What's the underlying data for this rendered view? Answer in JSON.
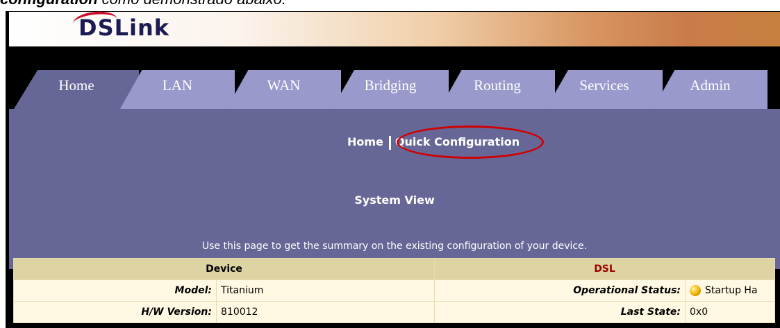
{
  "caption": {
    "bold_part": "configuration",
    "rest": " como demonstrado abaixo:"
  },
  "brand": {
    "logo_text": "DSLink"
  },
  "tabs": [
    {
      "label": "Home",
      "active": true
    },
    {
      "label": "LAN",
      "active": false
    },
    {
      "label": "WAN",
      "active": false
    },
    {
      "label": "Bridging",
      "active": false
    },
    {
      "label": "Routing",
      "active": false
    },
    {
      "label": "Services",
      "active": false
    },
    {
      "label": "Admin",
      "active": false
    }
  ],
  "subnav": {
    "home": "Home",
    "quick_config": "Quick Configuration"
  },
  "page": {
    "title": "System View",
    "description": "Use this page to get the summary on the existing configuration of your device."
  },
  "table": {
    "device_header": "Device",
    "dsl_header": "DSL",
    "rows": [
      {
        "label": "Model:",
        "value": "Titanium",
        "dsl_label": "Operational Status:",
        "dsl_value": "Startup Ha"
      },
      {
        "label": "H/W Version:",
        "value": "810012",
        "dsl_label": "Last State:",
        "dsl_value": "0x0"
      }
    ]
  },
  "colors": {
    "content_bg": "#676797",
    "tab_bg": "#9999cc",
    "table_header": "#ddd3a3",
    "table_row": "#fff9e3",
    "dsl_header": "#990000",
    "highlight": "#d00000"
  },
  "icons": {
    "status": "status-bulb-icon"
  }
}
